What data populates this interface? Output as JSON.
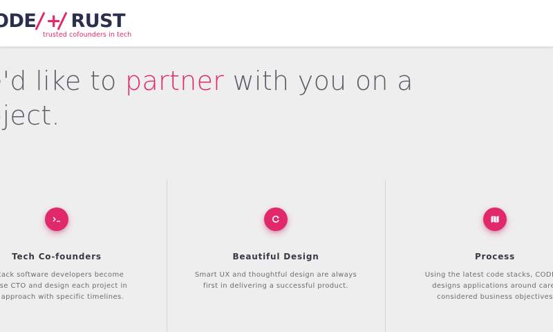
{
  "header": {
    "logo": {
      "part1": "ODE",
      "plus": "+",
      "part2": "RUST",
      "tagline": "trusted cofounders in tech"
    }
  },
  "hero": {
    "line1_before": "e'd like to ",
    "line1_highlight": "partner",
    "line1_after": " with you on a",
    "line2": "oject."
  },
  "features": [
    {
      "icon": "terminal-icon",
      "title": "Tech Co-founders",
      "desc_lines": [
        "l-stack software developers become",
        "house CTO and design each project in",
        "ed approach with specific timelines."
      ]
    },
    {
      "icon": "refresh-icon",
      "title": "Beautiful Design",
      "desc_lines": [
        "Smart UX and thoughtful design are always",
        "first in delivering a successful product."
      ]
    },
    {
      "icon": "map-icon",
      "title": "Process",
      "desc_lines": [
        "Using the latest code stacks, CODE/+",
        "designs applications around caref",
        "considered business objectives"
      ]
    }
  ],
  "colors": {
    "accent": "#e0286a",
    "brand_dark": "#2a2f4d",
    "background": "#efeeef"
  }
}
